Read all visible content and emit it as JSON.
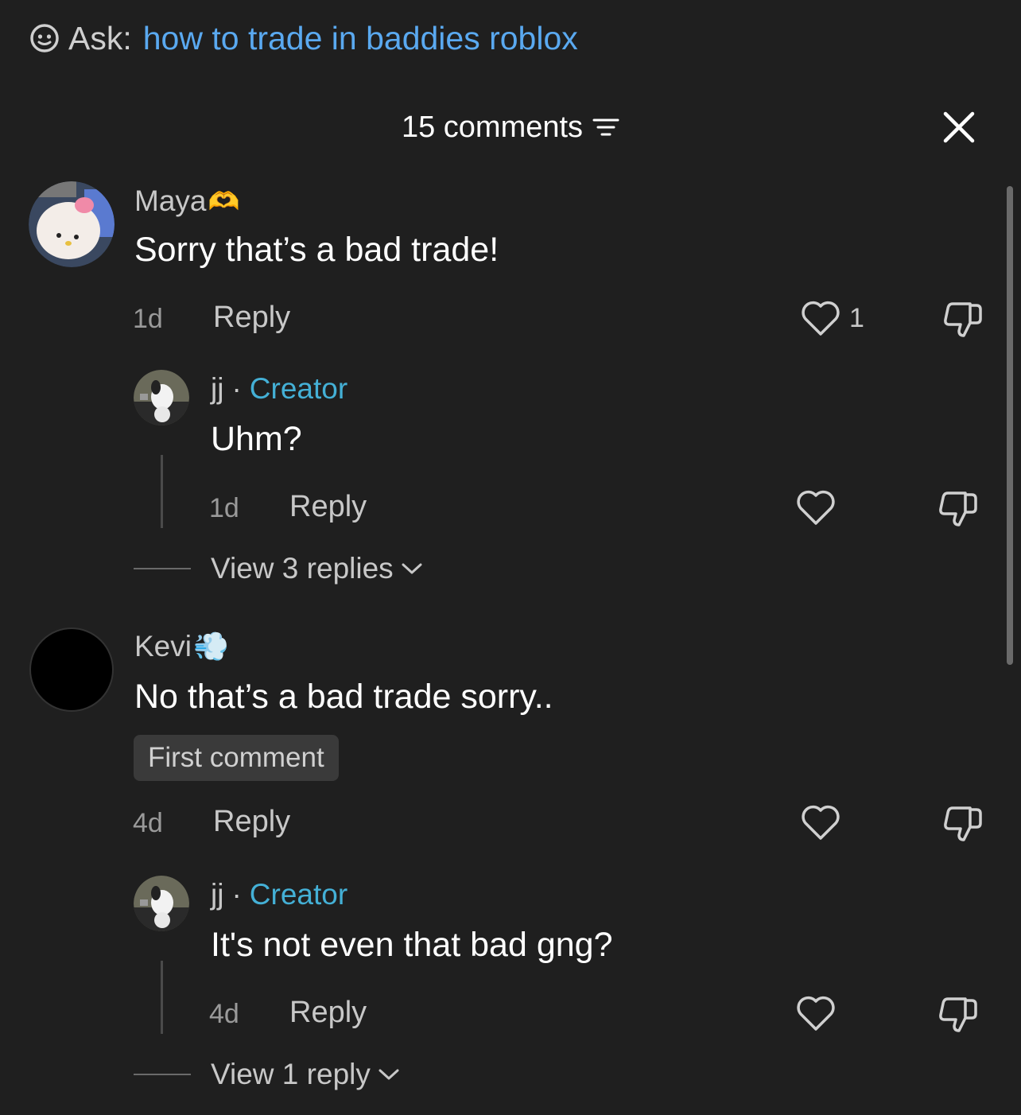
{
  "ask": {
    "label": "Ask:",
    "query": "how to trade in baddies roblox"
  },
  "header": {
    "count_label": "15 comments"
  },
  "icons": {
    "ask": "smiley-search-icon",
    "filter": "filter-icon",
    "close": "close-icon",
    "like": "heart-icon",
    "dislike": "thumbs-down-icon",
    "chevron": "chevron-down-icon"
  },
  "colors": {
    "background": "#1f1f1f",
    "link": "#5aa9f0",
    "creator": "#44b0d6"
  },
  "comments": [
    {
      "username": "Maya",
      "username_emoji": "🫶",
      "text": "Sorry that’s a bad trade!",
      "time": "1d",
      "reply_label": "Reply",
      "likes": "1",
      "replies": [
        {
          "username": "jj",
          "creator_label": "Creator",
          "text": "Uhm?",
          "time": "1d",
          "reply_label": "Reply"
        }
      ],
      "view_replies_label": "View 3 replies"
    },
    {
      "username": "Kevi",
      "username_emoji": "💨",
      "text": "No that’s a bad trade sorry..",
      "badge": "First comment",
      "time": "4d",
      "reply_label": "Reply",
      "replies": [
        {
          "username": "jj",
          "creator_label": "Creator",
          "text": "It's not even that bad gng?",
          "time": "4d",
          "reply_label": "Reply"
        }
      ],
      "view_replies_label": "View 1 reply"
    }
  ]
}
